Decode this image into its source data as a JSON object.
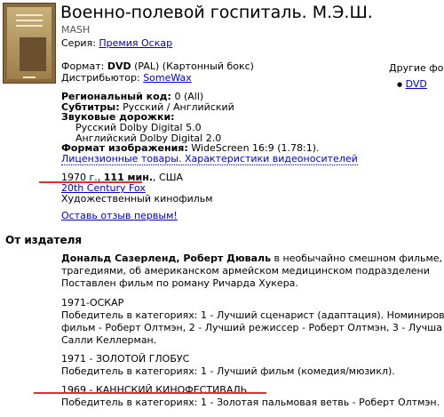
{
  "product": {
    "title": "Военно-полевой госпиталь. М.Э.Ш.",
    "original_title": "MASH",
    "series_label": "Серия:",
    "series_value": "Премия Оскар",
    "format_label": "Формат:",
    "format_value_bold": "DVD",
    "format_value_rest": "(PAL) (Картонный бокс)",
    "distributor_label": "Дистрибьютор:",
    "distributor_value": "SomeWax",
    "region_label": "Региональный код:",
    "region_value": "0 (All)",
    "subtitles_label": "Субтитры:",
    "subtitles_value": "Русский / Английский",
    "audio_label": "Звуковые дорожки:",
    "audio_tracks": [
      "Русский Dolby Digital 5.0",
      "Английский Dolby Digital 2.0"
    ],
    "image_format_label": "Формат изображения:",
    "image_format_value": "WideScreen 16:9 (1.78:1).",
    "license_link": "Лицензионные товары. Характеристики видеоносителей",
    "year": "1970 г.,",
    "duration": "111 мин.",
    "country": ", США",
    "studio": "20th Century Fox",
    "kind": "Художественный кинофильм",
    "review_link": "Оставь отзыв первым!"
  },
  "other_formats": {
    "heading": "Другие фо",
    "item": "DVD"
  },
  "publisher": {
    "heading": "От издателя",
    "intro_bold": "Дональд Сазерленд, Роберт Дюваль",
    "intro_lines": [
      " в необычайно смешном фильме, со",
      "трагедиями, об американском армейском медицинском подразделени",
      "Поставлен фильм по роману Ричарда Хукера."
    ],
    "awards": [
      {
        "title": "1971-ОСКАР",
        "lines": [
          "Победитель в категориях: 1 - Лучший сценарист (адаптация). Номиниров",
          "фильм - Роберт Олтмэн, 2 - Лучший режиссер - Роберт Олтмэн, 3 - Лучша",
          "Салли Келлерман."
        ]
      },
      {
        "title": "1971 - ЗОЛОТОЙ ГЛОБУС",
        "lines": [
          "Победитель в категориях: 1 - Лучший фильм (комедия/мюзикл)."
        ]
      },
      {
        "title": "1969 - КАННСКИЙ КИНОФЕСТИВАЛЬ",
        "lines": [
          "Победитель в категориях: 1 - Золотая пальмовая ветвь - Роберт Олтмэн."
        ]
      }
    ]
  },
  "colors": {
    "link": "#0000cc",
    "highlight": "#e0302a",
    "cover": "#8a6a3c"
  }
}
